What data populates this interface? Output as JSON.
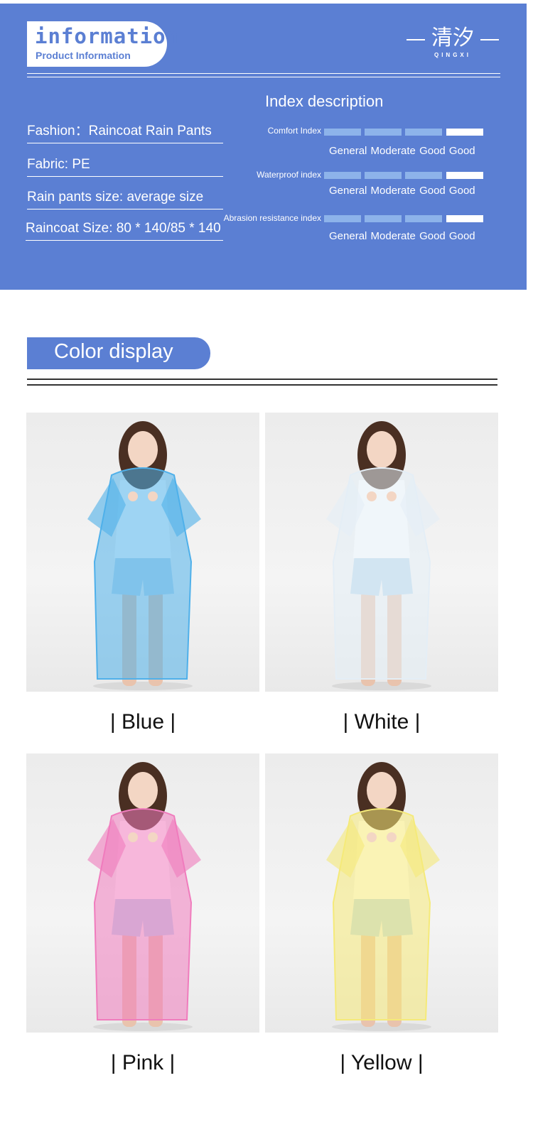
{
  "info": {
    "title": "information",
    "subtitle": "Product Information",
    "brand_glyphs": "清汐",
    "brand_latin": "QINGXI",
    "specs": [
      "Fashion：Raincoat Rain Pants",
      "Fabric: PE",
      "Rain pants size: average size",
      "Raincoat Size: 80 * 140/85 * 140"
    ],
    "index_heading": "Index description",
    "meters": [
      {
        "label": "Comfort Index",
        "level": 4,
        "scale": "General Moderate Good Good"
      },
      {
        "label": "Waterproof index",
        "level": 4,
        "scale": "General Moderate Good Good"
      },
      {
        "label": "Abrasion resistance index",
        "level": 4,
        "scale": "General Moderate Good Good"
      }
    ],
    "meter_segments": 4
  },
  "colors": {
    "heading": "Color display",
    "items": [
      {
        "name": "| Blue |",
        "swatch": "#4fb0ea"
      },
      {
        "name": "| White |",
        "swatch": "#e4eef6"
      },
      {
        "name": "| Pink |",
        "swatch": "#f07cbd"
      },
      {
        "name": "| Yellow |",
        "swatch": "#f5ea79"
      }
    ]
  },
  "theme": {
    "accent": "#5b7fd3",
    "bar_off": "#8db3ea",
    "bar_on": "#ffffff"
  }
}
